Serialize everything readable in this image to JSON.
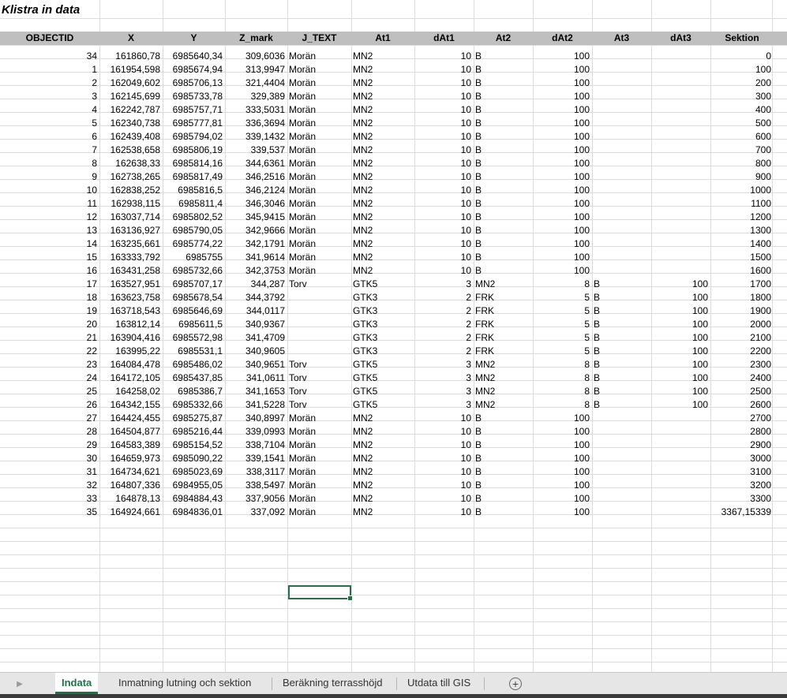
{
  "title": "Klistra in data",
  "columns": [
    "OBJECTID",
    "X",
    "Y",
    "Z_mark",
    "J_TEXT",
    "At1",
    "dAt1",
    "At2",
    "dAt2",
    "At3",
    "dAt3",
    "Sektion"
  ],
  "rows": [
    [
      "34",
      "161860,78",
      "6985640,34",
      "309,6036",
      "Morän",
      "MN2",
      "10",
      "B",
      "100",
      "",
      "",
      "0"
    ],
    [
      "1",
      "161954,598",
      "6985674,94",
      "313,9947",
      "Morän",
      "MN2",
      "10",
      "B",
      "100",
      "",
      "",
      "100"
    ],
    [
      "2",
      "162049,602",
      "6985706,13",
      "321,4404",
      "Morän",
      "MN2",
      "10",
      "B",
      "100",
      "",
      "",
      "200"
    ],
    [
      "3",
      "162145,699",
      "6985733,78",
      "329,389",
      "Morän",
      "MN2",
      "10",
      "B",
      "100",
      "",
      "",
      "300"
    ],
    [
      "4",
      "162242,787",
      "6985757,71",
      "333,5031",
      "Morän",
      "MN2",
      "10",
      "B",
      "100",
      "",
      "",
      "400"
    ],
    [
      "5",
      "162340,738",
      "6985777,81",
      "336,3694",
      "Morän",
      "MN2",
      "10",
      "B",
      "100",
      "",
      "",
      "500"
    ],
    [
      "6",
      "162439,408",
      "6985794,02",
      "339,1432",
      "Morän",
      "MN2",
      "10",
      "B",
      "100",
      "",
      "",
      "600"
    ],
    [
      "7",
      "162538,658",
      "6985806,19",
      "339,537",
      "Morän",
      "MN2",
      "10",
      "B",
      "100",
      "",
      "",
      "700"
    ],
    [
      "8",
      "162638,33",
      "6985814,16",
      "344,6361",
      "Morän",
      "MN2",
      "10",
      "B",
      "100",
      "",
      "",
      "800"
    ],
    [
      "9",
      "162738,265",
      "6985817,49",
      "346,2516",
      "Morän",
      "MN2",
      "10",
      "B",
      "100",
      "",
      "",
      "900"
    ],
    [
      "10",
      "162838,252",
      "6985816,5",
      "346,2124",
      "Morän",
      "MN2",
      "10",
      "B",
      "100",
      "",
      "",
      "1000"
    ],
    [
      "11",
      "162938,115",
      "6985811,4",
      "346,3046",
      "Morän",
      "MN2",
      "10",
      "B",
      "100",
      "",
      "",
      "1100"
    ],
    [
      "12",
      "163037,714",
      "6985802,52",
      "345,9415",
      "Morän",
      "MN2",
      "10",
      "B",
      "100",
      "",
      "",
      "1200"
    ],
    [
      "13",
      "163136,927",
      "6985790,05",
      "342,9666",
      "Morän",
      "MN2",
      "10",
      "B",
      "100",
      "",
      "",
      "1300"
    ],
    [
      "14",
      "163235,661",
      "6985774,22",
      "342,1791",
      "Morän",
      "MN2",
      "10",
      "B",
      "100",
      "",
      "",
      "1400"
    ],
    [
      "15",
      "163333,792",
      "6985755",
      "341,9614",
      "Morän",
      "MN2",
      "10",
      "B",
      "100",
      "",
      "",
      "1500"
    ],
    [
      "16",
      "163431,258",
      "6985732,66",
      "342,3753",
      "Morän",
      "MN2",
      "10",
      "B",
      "100",
      "",
      "",
      "1600"
    ],
    [
      "17",
      "163527,951",
      "6985707,17",
      "344,287",
      "Torv",
      "GTK5",
      "3",
      "MN2",
      "8",
      "B",
      "100",
      "1700"
    ],
    [
      "18",
      "163623,758",
      "6985678,54",
      "344,3792",
      "",
      "GTK3",
      "2",
      "FRK",
      "5",
      "B",
      "100",
      "1800"
    ],
    [
      "19",
      "163718,543",
      "6985646,69",
      "344,0117",
      "",
      "GTK3",
      "2",
      "FRK",
      "5",
      "B",
      "100",
      "1900"
    ],
    [
      "20",
      "163812,14",
      "6985611,5",
      "340,9367",
      "",
      "GTK3",
      "2",
      "FRK",
      "5",
      "B",
      "100",
      "2000"
    ],
    [
      "21",
      "163904,416",
      "6985572,98",
      "341,4709",
      "",
      "GTK3",
      "2",
      "FRK",
      "5",
      "B",
      "100",
      "2100"
    ],
    [
      "22",
      "163995,22",
      "6985531,1",
      "340,9605",
      "",
      "GTK3",
      "2",
      "FRK",
      "5",
      "B",
      "100",
      "2200"
    ],
    [
      "23",
      "164084,478",
      "6985486,02",
      "340,9651",
      "Torv",
      "GTK5",
      "3",
      "MN2",
      "8",
      "B",
      "100",
      "2300"
    ],
    [
      "24",
      "164172,105",
      "6985437,85",
      "341,0611",
      "Torv",
      "GTK5",
      "3",
      "MN2",
      "8",
      "B",
      "100",
      "2400"
    ],
    [
      "25",
      "164258,02",
      "6985386,7",
      "341,1653",
      "Torv",
      "GTK5",
      "3",
      "MN2",
      "8",
      "B",
      "100",
      "2500"
    ],
    [
      "26",
      "164342,155",
      "6985332,66",
      "341,5228",
      "Torv",
      "GTK5",
      "3",
      "MN2",
      "8",
      "B",
      "100",
      "2600"
    ],
    [
      "27",
      "164424,455",
      "6985275,87",
      "340,8997",
      "Morän",
      "MN2",
      "10",
      "B",
      "100",
      "",
      "",
      "2700"
    ],
    [
      "28",
      "164504,877",
      "6985216,44",
      "339,0993",
      "Morän",
      "MN2",
      "10",
      "B",
      "100",
      "",
      "",
      "2800"
    ],
    [
      "29",
      "164583,389",
      "6985154,52",
      "338,7104",
      "Morän",
      "MN2",
      "10",
      "B",
      "100",
      "",
      "",
      "2900"
    ],
    [
      "30",
      "164659,973",
      "6985090,22",
      "339,1541",
      "Morän",
      "MN2",
      "10",
      "B",
      "100",
      "",
      "",
      "3000"
    ],
    [
      "31",
      "164734,621",
      "6985023,69",
      "338,3117",
      "Morän",
      "MN2",
      "10",
      "B",
      "100",
      "",
      "",
      "3100"
    ],
    [
      "32",
      "164807,336",
      "6984955,05",
      "338,5497",
      "Morän",
      "MN2",
      "10",
      "B",
      "100",
      "",
      "",
      "3200"
    ],
    [
      "33",
      "164878,13",
      "6984884,43",
      "337,9056",
      "Morän",
      "MN2",
      "10",
      "B",
      "100",
      "",
      "",
      "3300"
    ],
    [
      "35",
      "164924,661",
      "6984836,01",
      "337,092",
      "Morän",
      "MN2",
      "10",
      "B",
      "100",
      "",
      "",
      "3367,15339"
    ]
  ],
  "tabs": [
    {
      "label": "Indata",
      "active": true
    },
    {
      "label": "Inmatning lutning och sektion",
      "active": false
    },
    {
      "label": "Beräkning terrasshöjd",
      "active": false
    },
    {
      "label": "Utdata till GIS",
      "active": false
    }
  ],
  "icons": {
    "tab_scroll": "triangle-right-icon",
    "add_sheet": "plus-circle-icon"
  },
  "colors": {
    "accent": "#217346",
    "header_bg": "#bfbfbf",
    "gridline": "#dadcdd"
  }
}
